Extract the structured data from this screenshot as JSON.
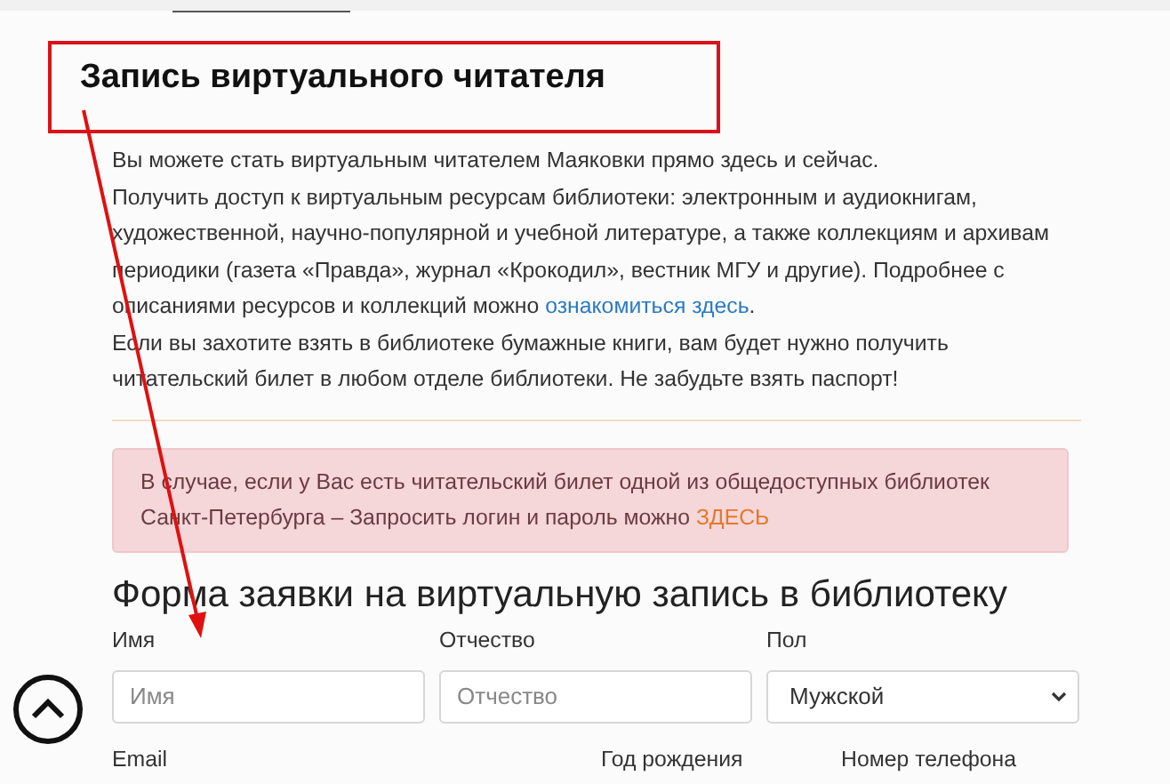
{
  "title": "Запись виртуального читателя",
  "intro": [
    {
      "text": "Вы можете стать виртуальным читателем Маяковки прямо здесь и сейчас."
    },
    {
      "text": "Получить доступ к виртуальным ресурсам библиотеки: электронным и аудиокнигам, художественной, научно-популярной и учебной литературе, а также коллекциям и архивам периодики (газета «Правда», журнал «Крокодил», вестник МГУ и другие). Подробнее с описаниями ресурсов и коллекций можно ",
      "link": "ознакомиться здесь",
      "after": "."
    },
    {
      "text": "Если вы захотите взять в библиотеке бумажные книги, вам будет нужно получить читательский билет в любом отделе библиотеки. Не забудьте взять паспорт!"
    }
  ],
  "alert": {
    "text": "В случае, если у Вас есть читательский билет одной из общедоступных библиотек Санкт-Петербурга – Запросить логин и пароль можно ",
    "link": "ЗДЕСЬ"
  },
  "form": {
    "heading": "Форма заявки на виртуальную запись в библиотеку",
    "fields": [
      {
        "kind": "input",
        "label": "Имя",
        "placeholder": "Имя"
      },
      {
        "kind": "input",
        "label": "Отчество",
        "placeholder": "Отчество"
      },
      {
        "kind": "select",
        "label": "Пол",
        "value": "Мужской"
      }
    ],
    "next_labels": [
      "Email",
      "Год рождения",
      "Номер телефона"
    ]
  }
}
